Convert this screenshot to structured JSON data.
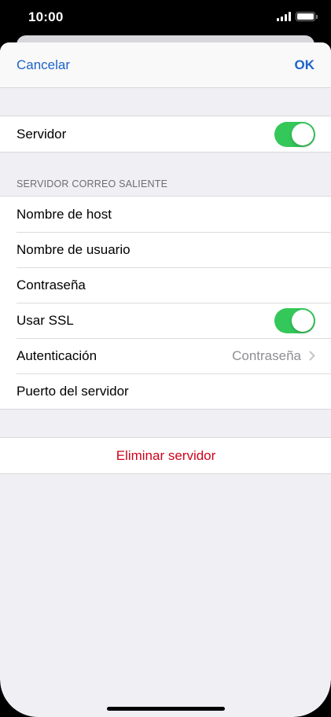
{
  "status_bar": {
    "time": "10:00",
    "signal_icon": "signal-bars-icon",
    "battery_icon": "battery-icon"
  },
  "nav": {
    "cancel_label": "Cancelar",
    "ok_label": "OK"
  },
  "server_toggle": {
    "label": "Servidor",
    "on": true
  },
  "outgoing": {
    "header": "SERVIDOR CORREO SALIENTE",
    "host_label": "Nombre de host",
    "user_label": "Nombre de usuario",
    "password_label": "Contraseña",
    "ssl_label": "Usar SSL",
    "ssl_on": true,
    "auth_label": "Autenticación",
    "auth_value": "Contraseña",
    "port_label": "Puerto del servidor"
  },
  "delete_label": "Eliminar servidor",
  "colors": {
    "accent": "#1c63c8",
    "toggle_on": "#34c759",
    "destructive": "#d0021b",
    "background": "#efeff4"
  }
}
